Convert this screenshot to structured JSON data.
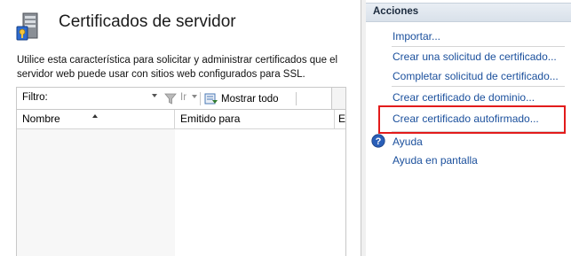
{
  "main": {
    "title": "Certificados de servidor",
    "description": "Utilice esta característica para solicitar y administrar certificados que el servidor web puede usar con sitios web configurados para SSL.",
    "icons": [
      "server-icon",
      "funnel-icon",
      "show-all-icon",
      "dropdown-arrow-icon",
      "sort-up-arrow-icon"
    ]
  },
  "toolbar": {
    "filter_label": "Filtro:",
    "filter_value": "",
    "go_label": "Ir",
    "show_all_label": "Mostrar todo"
  },
  "grid": {
    "columns": [
      "Nombre",
      "Emitido para",
      "Emi"
    ],
    "sorted_column": "Nombre",
    "sort_direction": "ascending",
    "rows": []
  },
  "actions": {
    "header": "Acciones",
    "groups": [
      [
        {
          "label": "Importar..."
        }
      ],
      [
        {
          "label": "Crear una solicitud de certificado..."
        },
        {
          "label": "Completar solicitud de certificado..."
        }
      ],
      [
        {
          "label": "Crear certificado de dominio..."
        }
      ],
      [
        {
          "label": "Crear certificado autofirmado...",
          "highlighted": true
        }
      ],
      [
        {
          "label": "Ayuda",
          "icon": "help-icon"
        },
        {
          "label": "Ayuda en pantalla"
        }
      ]
    ]
  },
  "colors": {
    "link": "#1a4f9c",
    "highlight_border": "#e21b1b",
    "actions_header_bg": "#dde4ec"
  }
}
